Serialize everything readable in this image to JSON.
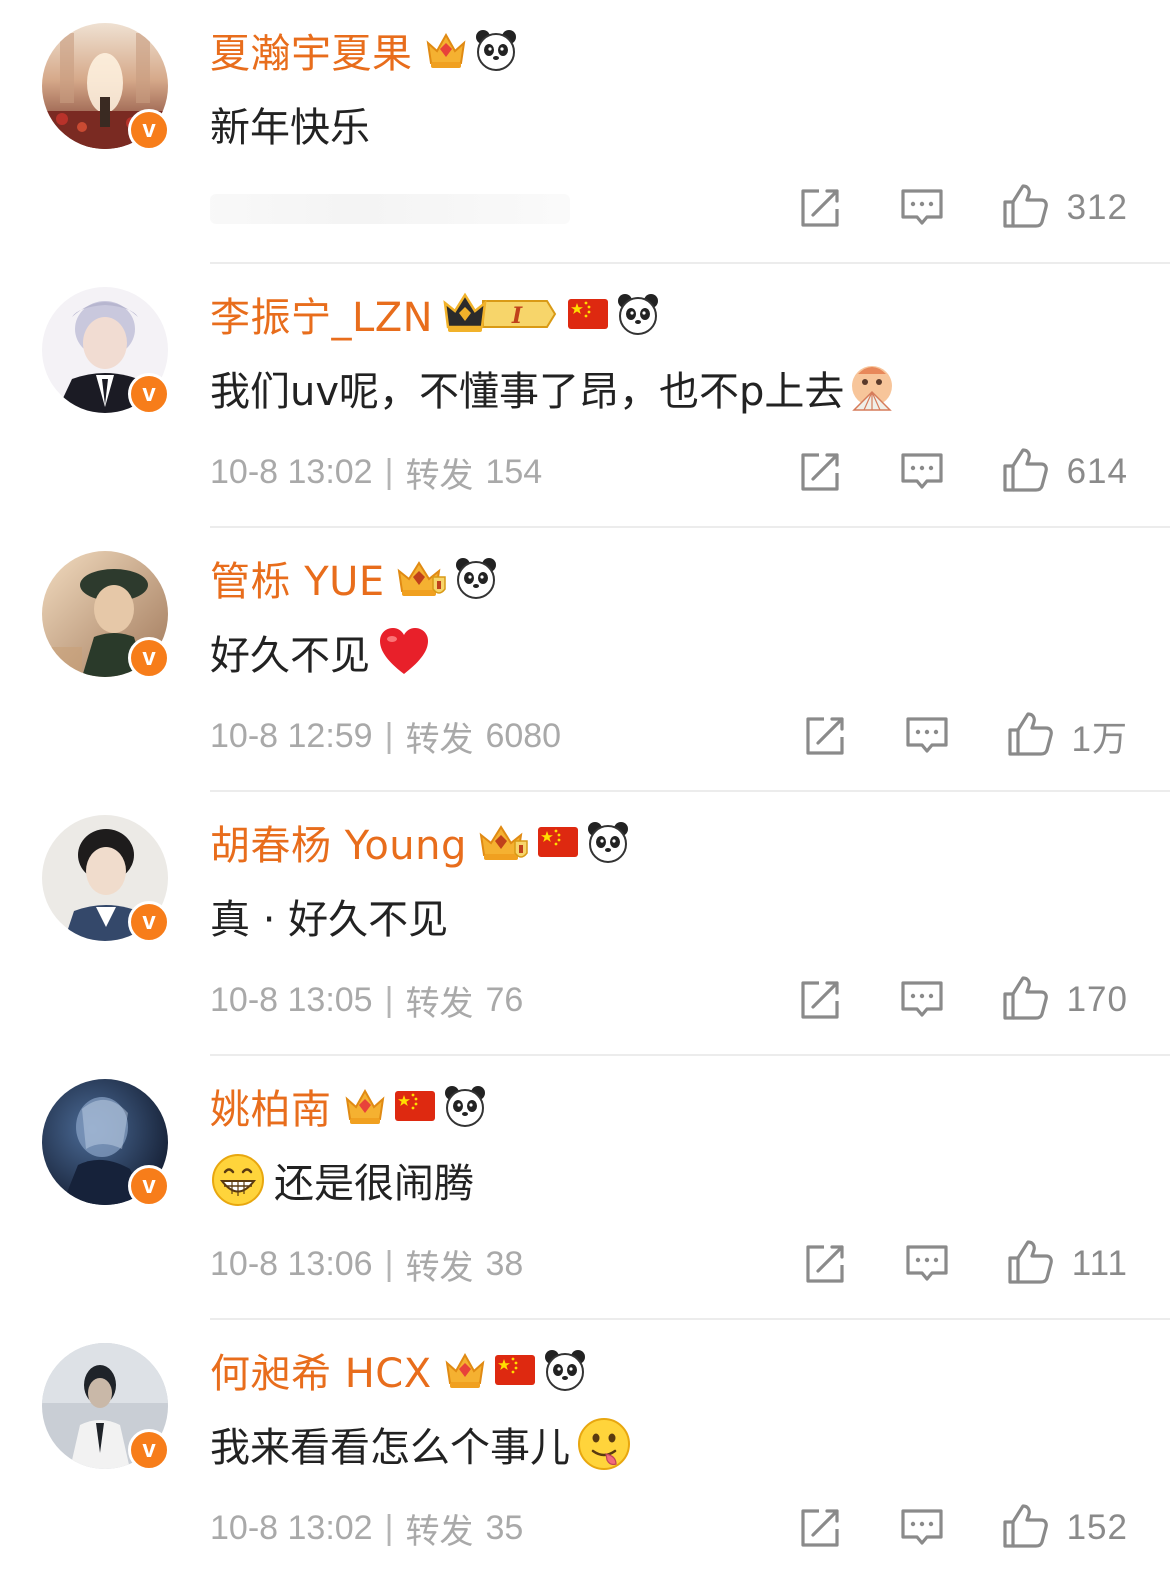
{
  "comments": [
    {
      "username": "夏瀚宇夏果",
      "text": "新年快乐",
      "date": "",
      "repost_label": "",
      "repost_count": "",
      "likes": "312",
      "badges": [
        "crown-gem",
        "panda"
      ],
      "emoji": "",
      "avatar_colors": [
        "#f2d9c4",
        "#a8623c",
        "#5a2f1c"
      ]
    },
    {
      "username": "李振宁_LZN",
      "text": "我们uv呢，不懂事了昂，也不p上去",
      "date": "10-8 13:02",
      "repost_label": "转发",
      "repost_count": "154",
      "likes": "614",
      "badges": [
        "crown-level",
        "china-flag",
        "panda"
      ],
      "level_label": "I",
      "emoji": "fan-face",
      "avatar_colors": [
        "#e6e2ea",
        "#9ea0b8",
        "#1a1a22"
      ]
    },
    {
      "username": "管栎 YUE",
      "text": "好久不见",
      "date": "10-8 12:59",
      "repost_label": "转发",
      "repost_count": "6080",
      "likes": "1万",
      "badges": [
        "crown-shield",
        "panda"
      ],
      "emoji": "red-heart",
      "avatar_colors": [
        "#e9d2b8",
        "#8d7058",
        "#2c3a2c"
      ]
    },
    {
      "username": "胡春杨 Young",
      "text": "真 · 好久不见",
      "date": "10-8 13:05",
      "repost_label": "转发",
      "repost_count": "76",
      "likes": "170",
      "badges": [
        "crown-shield",
        "china-flag",
        "panda"
      ],
      "emoji": "",
      "avatar_colors": [
        "#ecebe8",
        "#c9b8a6",
        "#2d3d5c"
      ]
    },
    {
      "username": "姚柏南",
      "text": "还是很闹腾",
      "date": "10-8 13:06",
      "repost_label": "转发",
      "repost_count": "38",
      "likes": "111",
      "badges": [
        "crown-gem",
        "china-flag",
        "panda"
      ],
      "emoji_lead": "grin-face",
      "emoji": "",
      "avatar_colors": [
        "#1d2740",
        "#4b6a94",
        "#0c1222"
      ]
    },
    {
      "username": "何昶希 HCX",
      "text": "我来看看怎么个事儿",
      "date": "10-8 13:02",
      "repost_label": "转发",
      "repost_count": "35",
      "likes": "152",
      "badges": [
        "crown-gem",
        "china-flag",
        "panda"
      ],
      "emoji": "tongue-face",
      "avatar_colors": [
        "#d7dbe0",
        "#8e969f",
        "#2a2f36"
      ]
    }
  ],
  "verified_badge": "v",
  "colors": {
    "username": "#e86d1c",
    "verified": "#f77d1a",
    "meta": "#a9a9a9",
    "icon": "#8a8a8a",
    "divider": "#ececec"
  }
}
